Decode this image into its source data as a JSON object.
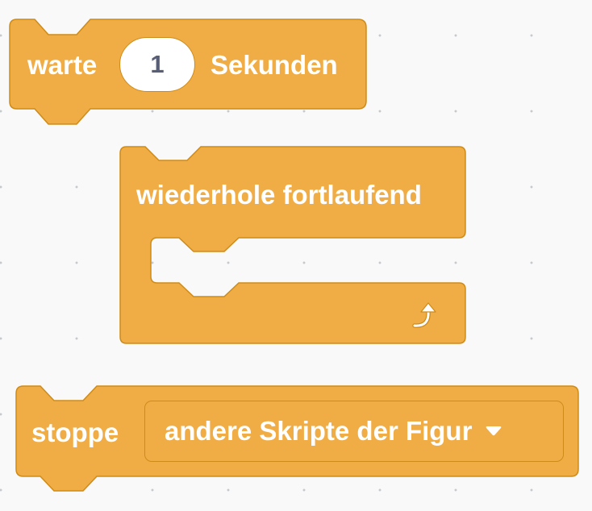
{
  "workspace": "scratch-code-area",
  "colors": {
    "control_block": "#f1ad45",
    "control_border": "#cf8b17",
    "text": "#ffffff",
    "input_text": "#575e75",
    "background": "#f9f9f9"
  },
  "blocks": {
    "wait": {
      "prefix": "warte",
      "value": "1",
      "suffix": "Sekunden"
    },
    "forever": {
      "label": "wiederhole fortlaufend",
      "end_icon": "loop-arrow-icon"
    },
    "stop": {
      "label": "stoppe",
      "option": "andere Skripte der Figur",
      "option_icon": "dropdown-arrow-icon"
    }
  }
}
